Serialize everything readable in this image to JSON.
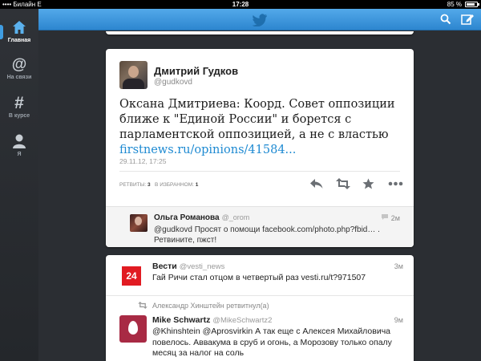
{
  "status_bar": {
    "carrier": "•••• Билайн",
    "network": "E",
    "time": "17:28",
    "battery": "85 %",
    "battery_level": 0.85
  },
  "sidebar": {
    "items": [
      {
        "label": "Главная",
        "icon": "home-icon"
      },
      {
        "label": "На связи",
        "icon": "at-icon"
      },
      {
        "label": "В курсе",
        "icon": "hash-icon"
      },
      {
        "label": "Я",
        "icon": "person-icon"
      }
    ],
    "active_index": 0
  },
  "header": {
    "logo_icon": "twitter-bird-icon",
    "search_icon": "search-icon",
    "compose_icon": "compose-icon"
  },
  "tweet": {
    "author_name": "Дмитрий Гудков",
    "author_handle": "@gudkovd",
    "text": "Оксана Дмитриева: Коорд. Совет оппозиции ближе к \"Единой России\" и борется с парламентской оппозицией, а не с властью",
    "link": "firstnews.ru/opinions/41584...",
    "date": "29.11.12, 17:25",
    "retweets_label": "РЕТВИТЫ:",
    "retweets_count": "3",
    "favorites_label": "В ИЗБРАННОМ:",
    "favorites_count": "1",
    "actions": [
      "reply-icon",
      "retweet-icon",
      "favorite-star-icon",
      "more-icon"
    ]
  },
  "reply": {
    "name": "Ольга Романова",
    "handle": "@_orom",
    "time": "2м",
    "text": "@gudkovd Просят о помощи facebook.com/photo.php?fbid… . Ретвините, пжст!"
  },
  "feed": [
    {
      "name": "Вести",
      "handle": "@vesti_news",
      "time": "3м",
      "avatar_text": "24",
      "text": "Гай Ричи стал отцом в четвертый раз vesti.ru/t?971507"
    },
    {
      "retweeted_by": "Александр Хинштейн ретвитнул(а)",
      "name": "Mike Schwartz",
      "handle": "@MikeSchwartz2",
      "time": "9м",
      "text": "@Khinshtein @Aprosvirkin А так еще с Алексея Михайловича повелось. Аввакума в сруб и огонь, а Морозову только опалу месяц за налог на соль"
    }
  ],
  "colors": {
    "accent": "#2d86cf",
    "link": "#1e8ad2",
    "sidebar": "#2b2e33"
  }
}
